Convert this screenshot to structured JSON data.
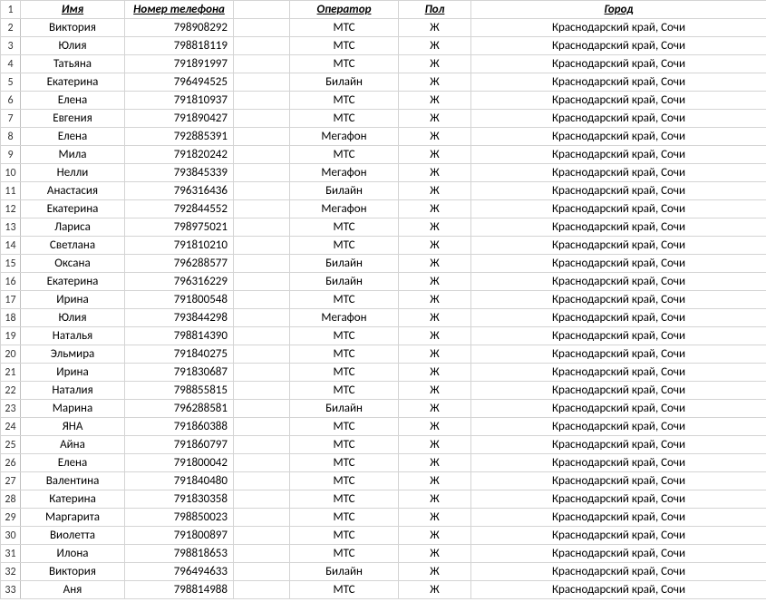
{
  "headers": {
    "rownum": "1",
    "name": "Имя",
    "phone": "Номер телефона",
    "operator": "Оператор",
    "gender": "Пол",
    "city": "Город"
  },
  "rows": [
    {
      "n": "2",
      "name": "Виктория",
      "phone": "798908292",
      "operator": "МТС",
      "gender": "Ж",
      "city": "Краснодарский край, Сочи"
    },
    {
      "n": "3",
      "name": "Юлия",
      "phone": "798818119",
      "operator": "МТС",
      "gender": "Ж",
      "city": "Краснодарский край, Сочи"
    },
    {
      "n": "4",
      "name": "Татьяна",
      "phone": "791891997",
      "operator": "МТС",
      "gender": "Ж",
      "city": "Краснодарский край, Сочи"
    },
    {
      "n": "5",
      "name": "Екатерина",
      "phone": "796494525",
      "operator": "Билайн",
      "gender": "Ж",
      "city": "Краснодарский край, Сочи"
    },
    {
      "n": "6",
      "name": "Елена",
      "phone": "791810937",
      "operator": "МТС",
      "gender": "Ж",
      "city": "Краснодарский край, Сочи"
    },
    {
      "n": "7",
      "name": "Евгения",
      "phone": "791890427",
      "operator": "МТС",
      "gender": "Ж",
      "city": "Краснодарский край, Сочи"
    },
    {
      "n": "8",
      "name": "Елена",
      "phone": "792885391",
      "operator": "Мегафон",
      "gender": "Ж",
      "city": "Краснодарский край, Сочи"
    },
    {
      "n": "9",
      "name": "Мила",
      "phone": "791820242",
      "operator": "МТС",
      "gender": "Ж",
      "city": "Краснодарский край, Сочи"
    },
    {
      "n": "10",
      "name": "Нелли",
      "phone": "793845339",
      "operator": "Мегафон",
      "gender": "Ж",
      "city": "Краснодарский край, Сочи"
    },
    {
      "n": "11",
      "name": "Анастасия",
      "phone": "796316436",
      "operator": "Билайн",
      "gender": "Ж",
      "city": "Краснодарский край, Сочи"
    },
    {
      "n": "12",
      "name": "Екатерина",
      "phone": "792844552",
      "operator": "Мегафон",
      "gender": "Ж",
      "city": "Краснодарский край, Сочи"
    },
    {
      "n": "13",
      "name": "Лариса",
      "phone": "798975021",
      "operator": "МТС",
      "gender": "Ж",
      "city": "Краснодарский край, Сочи"
    },
    {
      "n": "14",
      "name": "Светлана",
      "phone": "791810210",
      "operator": "МТС",
      "gender": "Ж",
      "city": "Краснодарский край, Сочи"
    },
    {
      "n": "15",
      "name": "Оксана",
      "phone": "796288577",
      "operator": "Билайн",
      "gender": "Ж",
      "city": "Краснодарский край, Сочи"
    },
    {
      "n": "16",
      "name": "Екатерина",
      "phone": "796316229",
      "operator": "Билайн",
      "gender": "Ж",
      "city": "Краснодарский край, Сочи"
    },
    {
      "n": "17",
      "name": "Ирина",
      "phone": "791800548",
      "operator": "МТС",
      "gender": "Ж",
      "city": "Краснодарский край, Сочи"
    },
    {
      "n": "18",
      "name": "Юлия",
      "phone": "793844298",
      "operator": "Мегафон",
      "gender": "Ж",
      "city": "Краснодарский край, Сочи"
    },
    {
      "n": "19",
      "name": "Наталья",
      "phone": "798814390",
      "operator": "МТС",
      "gender": "Ж",
      "city": "Краснодарский край, Сочи"
    },
    {
      "n": "20",
      "name": "Эльмира",
      "phone": "791840275",
      "operator": "МТС",
      "gender": "Ж",
      "city": "Краснодарский край, Сочи"
    },
    {
      "n": "21",
      "name": "Ирина",
      "phone": "791830687",
      "operator": "МТС",
      "gender": "Ж",
      "city": "Краснодарский край, Сочи"
    },
    {
      "n": "22",
      "name": "Наталия",
      "phone": "798855815",
      "operator": "МТС",
      "gender": "Ж",
      "city": "Краснодарский край, Сочи"
    },
    {
      "n": "23",
      "name": "Марина",
      "phone": "796288581",
      "operator": "Билайн",
      "gender": "Ж",
      "city": "Краснодарский край, Сочи"
    },
    {
      "n": "24",
      "name": "ЯНА",
      "phone": "791860388",
      "operator": "МТС",
      "gender": "Ж",
      "city": "Краснодарский край, Сочи"
    },
    {
      "n": "25",
      "name": "Айна",
      "phone": "791860797",
      "operator": "МТС",
      "gender": "Ж",
      "city": "Краснодарский край, Сочи"
    },
    {
      "n": "26",
      "name": "Елена",
      "phone": "791800042",
      "operator": "МТС",
      "gender": "Ж",
      "city": "Краснодарский край, Сочи"
    },
    {
      "n": "27",
      "name": "Валентина",
      "phone": "791840480",
      "operator": "МТС",
      "gender": "Ж",
      "city": "Краснодарский край, Сочи"
    },
    {
      "n": "28",
      "name": "Катерина",
      "phone": "791830358",
      "operator": "МТС",
      "gender": "Ж",
      "city": "Краснодарский край, Сочи"
    },
    {
      "n": "29",
      "name": "Маргарита",
      "phone": "798850023",
      "operator": "МТС",
      "gender": "Ж",
      "city": "Краснодарский край, Сочи"
    },
    {
      "n": "30",
      "name": "Виолетта",
      "phone": "791800897",
      "operator": "МТС",
      "gender": "Ж",
      "city": "Краснодарский край, Сочи"
    },
    {
      "n": "31",
      "name": "Илона",
      "phone": "798818653",
      "operator": "МТС",
      "gender": "Ж",
      "city": "Краснодарский край, Сочи"
    },
    {
      "n": "32",
      "name": "Виктория",
      "phone": "796494633",
      "operator": "Билайн",
      "gender": "Ж",
      "city": "Краснодарский край, Сочи"
    },
    {
      "n": "33",
      "name": "Аня",
      "phone": "798814988",
      "operator": "МТС",
      "gender": "Ж",
      "city": "Краснодарский край, Сочи"
    }
  ]
}
